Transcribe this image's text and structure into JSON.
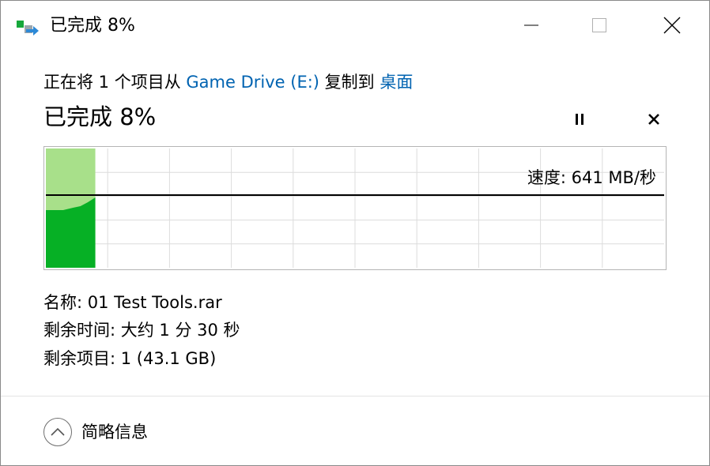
{
  "window": {
    "title": "已完成 8%",
    "icon": "copy-progress-icon",
    "buttons": {
      "minimize": "minimize-icon",
      "maximize": "maximize-icon",
      "close": "close-icon"
    }
  },
  "header": {
    "prefix": "正在将 1 个项目从 ",
    "source": "Game Drive (E:)",
    "middle": " 复制到 ",
    "destination": "桌面"
  },
  "progress": {
    "title": "已完成 8%",
    "percent": 8,
    "pause_icon": "pause-icon",
    "cancel_icon": "cancel-icon"
  },
  "graph": {
    "speed_label": "速度: 641 MB/秒",
    "colors": {
      "progress_fill": "#a8e08a",
      "speed_fill": "#06b025",
      "line": "#000000",
      "grid": "#dcdcdc"
    }
  },
  "details": {
    "name": "名称: 01 Test Tools.rar",
    "time_remaining": "剩余时间: 大约 1 分 30 秒",
    "items_remaining": "剩余项目: 1 (43.1 GB)"
  },
  "footer": {
    "toggle_label": "简略信息",
    "toggle_icon": "chevron-up-icon"
  }
}
